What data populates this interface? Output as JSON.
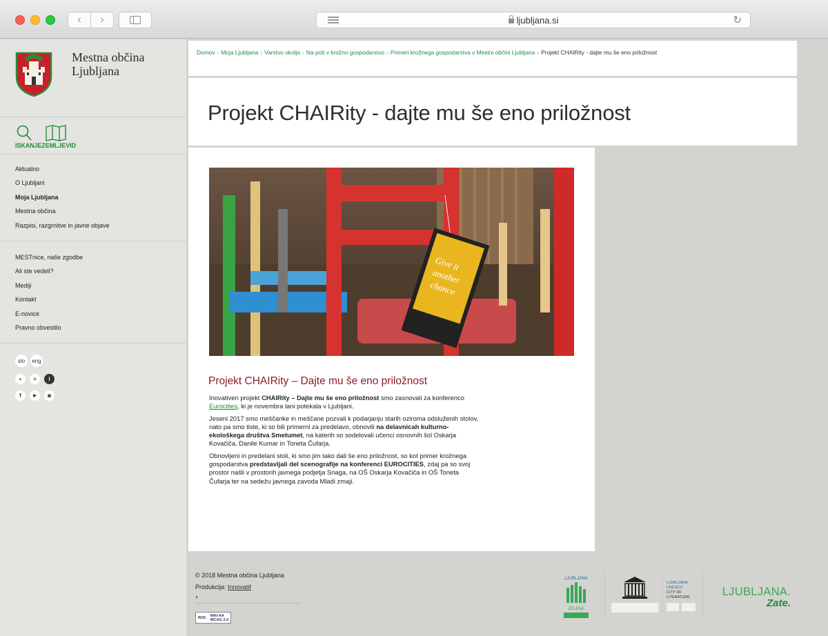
{
  "browser": {
    "url": "ljubljana.si"
  },
  "sidebar": {
    "brand": [
      "Mestna občina",
      "Ljubljana"
    ],
    "tools_label": "ISKANJEZEMLJEVID",
    "menu_primary": [
      {
        "label": "Aktualno",
        "active": false
      },
      {
        "label": "O Ljubljani",
        "active": false
      },
      {
        "label": "Moja Ljubljana",
        "active": true
      },
      {
        "label": "Mestna občina",
        "active": false
      },
      {
        "label": "Razpisi, razgrnitve in javne objave",
        "active": false
      }
    ],
    "menu_secondary": [
      {
        "label": "MESTnice, naše zgodbe"
      },
      {
        "label": "Ali ste vedeli?"
      },
      {
        "label": "Mediji"
      },
      {
        "label": "Kontakt"
      },
      {
        "label": "E-novice"
      },
      {
        "label": "Pravno obvestilo"
      }
    ],
    "languages": [
      "slo",
      "eng"
    ],
    "social_row1": [
      "rss",
      "≡",
      "i"
    ],
    "social_row2": [
      "f",
      "yt",
      "ig"
    ]
  },
  "breadcrumb": {
    "items": [
      "Domov",
      "Moja Ljubljana",
      "Varstvo okolja",
      "Na poti v krožno gospodarstvo",
      "Primeri krožnega gospodarstva v Mestni občini Ljubljana"
    ],
    "current": "Projekt CHAIRity - dajte mu še eno priložnost"
  },
  "page": {
    "title": "Projekt CHAIRity - dajte mu še eno priložnost"
  },
  "article": {
    "tag_text": [
      "Give it",
      "another",
      "chance"
    ],
    "heading": "Projekt CHAIRity – Dajte mu še eno priložnost",
    "p1": {
      "a": "Inovativen projekt ",
      "b": "CHAIRity – Dajte mu še eno priložnost",
      "c": " smo zasnovali za konferenco ",
      "link": "Eurocities",
      "d": ", ki je novembra lani potekala v Ljubljani."
    },
    "p2": {
      "a": "Jeseni 2017 smo meščanke in meščane pozvali k podarjanju starih oziroma odsluženih stolov, nato pa smo tiste, ki so bili primerni za predelavo, obnovili ",
      "b": "na delavnicah kulturno-ekološkega društva Smetumet",
      "c": ", na katerih so sodelovali učenci osnovnih šol Oskarja Kovačiča, Danile Kumar in Toneta Čufarja."
    },
    "p3": {
      "a": "Obnovljeni in predelani stoli, ki smo jim tako dali še eno priložnost, so kot primer krožnega gospodarstva ",
      "b": "predstavljali del scenografije na konferenci EUROCITIES",
      "c": ", zdaj pa so svoj prostor našli v prostorih javnega podjetja Snaga, na OŠ Oskarja Kovačiča in OŠ Toneta Čufarja ter na sedežu javnega zavoda Mladi zmaji."
    }
  },
  "footer": {
    "copyright": "© 2018 Mestna občina Ljubljana",
    "production_label": "Produkcija: ",
    "production_link": "Innovatif",
    "w3c": [
      "W3C",
      "WAI-AA",
      "WCAG 2.0"
    ],
    "zelena": [
      "LJUBLJANA",
      "ZELENA"
    ],
    "unesco_text": [
      "LJUBLJANA",
      "UNESCO",
      "CITY OF",
      "LITERATURE"
    ],
    "ljubljana_zate": [
      "LJUBLJANA.",
      "Zate."
    ]
  }
}
